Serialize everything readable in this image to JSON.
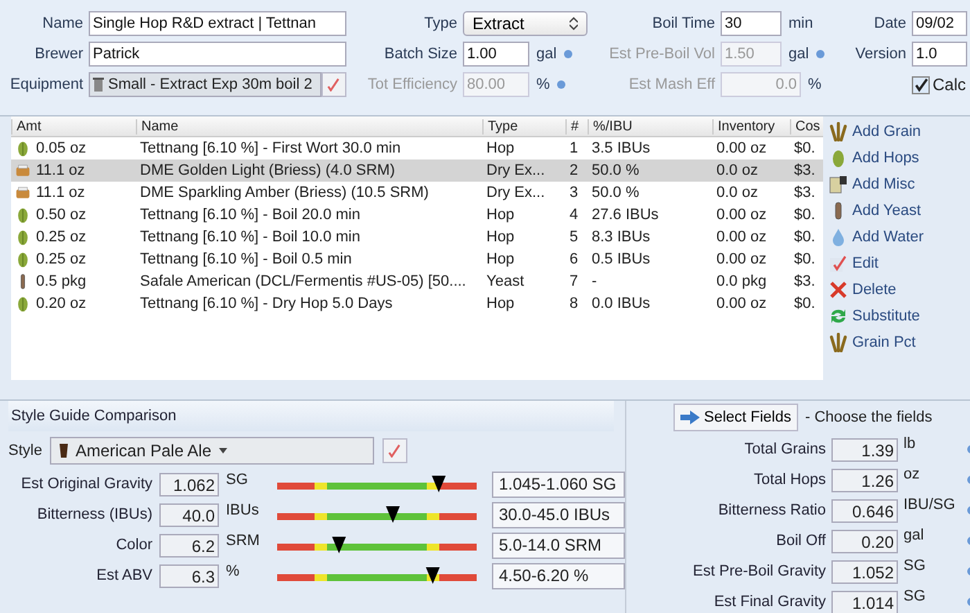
{
  "recipe": {
    "name_label": "Name",
    "name": "Single Hop R&D extract | Tettnan",
    "brewer_label": "Brewer",
    "brewer": "Patrick",
    "equipment_label": "Equipment",
    "equipment": "Small - Extract Exp 30m boil 2",
    "type_label": "Type",
    "type": "Extract",
    "batch_label": "Batch Size",
    "batch": "1.00",
    "batch_unit": "gal",
    "eff_label": "Tot Efficiency",
    "eff": "80.00",
    "eff_unit": "%",
    "boil_label": "Boil Time",
    "boil": "30",
    "boil_unit": "min",
    "preboil_label": "Est Pre-Boil Vol",
    "preboil": "1.50",
    "preboil_unit": "gal",
    "mash_label": "Est Mash Eff",
    "mash": "0.0",
    "mash_unit": "%",
    "date_label": "Date",
    "date": "09/02",
    "version_label": "Version",
    "version": "1.0",
    "calc_label": "Calc",
    "calc_checked": true
  },
  "table": {
    "columns": [
      "Amt",
      "Name",
      "Type",
      "#",
      "%/IBU",
      "Inventory",
      "Cos"
    ],
    "rows": [
      {
        "kind": "hop",
        "amt": "0.05 oz",
        "name": "Tettnang [6.10 %] - First Wort 30.0 min",
        "type": "Hop",
        "num": "1",
        "ibu": "3.5 IBUs",
        "inventory": "0.00 oz",
        "cost": "$0.",
        "selected": false
      },
      {
        "kind": "extract",
        "amt": "11.1 oz",
        "name": "DME Golden Light (Briess) (4.0 SRM)",
        "type": "Dry Ex...",
        "num": "2",
        "ibu": "50.0 %",
        "inventory": "0.0 oz",
        "cost": "$3.",
        "selected": true
      },
      {
        "kind": "extract",
        "amt": "11.1 oz",
        "name": "DME Sparkling Amber (Briess) (10.5 SRM)",
        "type": "Dry Ex...",
        "num": "3",
        "ibu": "50.0 %",
        "inventory": "0.0 oz",
        "cost": "$3.",
        "selected": false
      },
      {
        "kind": "hop",
        "amt": "0.50 oz",
        "name": "Tettnang [6.10 %] - Boil 20.0 min",
        "type": "Hop",
        "num": "4",
        "ibu": "27.6 IBUs",
        "inventory": "0.00 oz",
        "cost": "$0.",
        "selected": false
      },
      {
        "kind": "hop",
        "amt": "0.25 oz",
        "name": "Tettnang [6.10 %] - Boil 10.0 min",
        "type": "Hop",
        "num": "5",
        "ibu": "8.3 IBUs",
        "inventory": "0.00 oz",
        "cost": "$0.",
        "selected": false
      },
      {
        "kind": "hop",
        "amt": "0.25 oz",
        "name": "Tettnang [6.10 %] - Boil 0.5 min",
        "type": "Hop",
        "num": "6",
        "ibu": "0.5 IBUs",
        "inventory": "0.00 oz",
        "cost": "$0.",
        "selected": false
      },
      {
        "kind": "yeast",
        "amt": "0.5 pkg",
        "name": "Safale American (DCL/Fermentis #US-05) [50....",
        "type": "Yeast",
        "num": "7",
        "ibu": "-",
        "inventory": "0.0 pkg",
        "cost": "$3.",
        "selected": false
      },
      {
        "kind": "hop",
        "amt": "0.20 oz",
        "name": "Tettnang [6.10 %] - Dry Hop 5.0 Days",
        "type": "Hop",
        "num": "8",
        "ibu": "0.0 IBUs",
        "inventory": "0.00 oz",
        "cost": "$0.",
        "selected": false
      }
    ]
  },
  "actions": [
    {
      "kind": "grain",
      "label": "Add Grain"
    },
    {
      "kind": "hops",
      "label": "Add Hops"
    },
    {
      "kind": "misc",
      "label": "Add Misc"
    },
    {
      "kind": "yeast",
      "label": "Add Yeast"
    },
    {
      "kind": "water",
      "label": "Add Water"
    },
    {
      "kind": "edit",
      "label": "Edit"
    },
    {
      "kind": "delete",
      "label": "Delete"
    },
    {
      "kind": "substitute",
      "label": "Substitute"
    },
    {
      "kind": "grain",
      "label": "Grain Pct"
    }
  ],
  "style_guide": {
    "title": "Style Guide Comparison",
    "style_label": "Style",
    "style": "American Pale Ale",
    "rows": [
      {
        "label": "Est Original Gravity",
        "value": "1.062",
        "unit": "SG",
        "level": 0.81,
        "range": "1.045-1.060 SG"
      },
      {
        "label": "Bitterness (IBUs)",
        "value": "40.0",
        "unit": "IBUs",
        "level": 0.58,
        "range": "30.0-45.0 IBUs"
      },
      {
        "label": "Color",
        "value": "6.2",
        "unit": "SRM",
        "level": 0.31,
        "range": "5.0-14.0 SRM"
      },
      {
        "label": "Est ABV",
        "value": "6.3",
        "unit": "%",
        "level": 0.78,
        "range": "4.50-6.20 %"
      }
    ]
  },
  "stats": {
    "button": "Select Fields",
    "hint": "- Choose the fields",
    "rows": [
      {
        "label": "Total Grains",
        "value": "1.39",
        "unit": "lb"
      },
      {
        "label": "Total Hops",
        "value": "1.26",
        "unit": "oz"
      },
      {
        "label": "Bitterness Ratio",
        "value": "0.646",
        "unit": "IBU/SG"
      },
      {
        "label": "Boil Off",
        "value": "0.20",
        "unit": "gal"
      },
      {
        "label": "Est Pre-Boil Gravity",
        "value": "1.052",
        "unit": "SG"
      },
      {
        "label": "Est Final Gravity",
        "value": "1.014",
        "unit": "SG"
      }
    ]
  }
}
